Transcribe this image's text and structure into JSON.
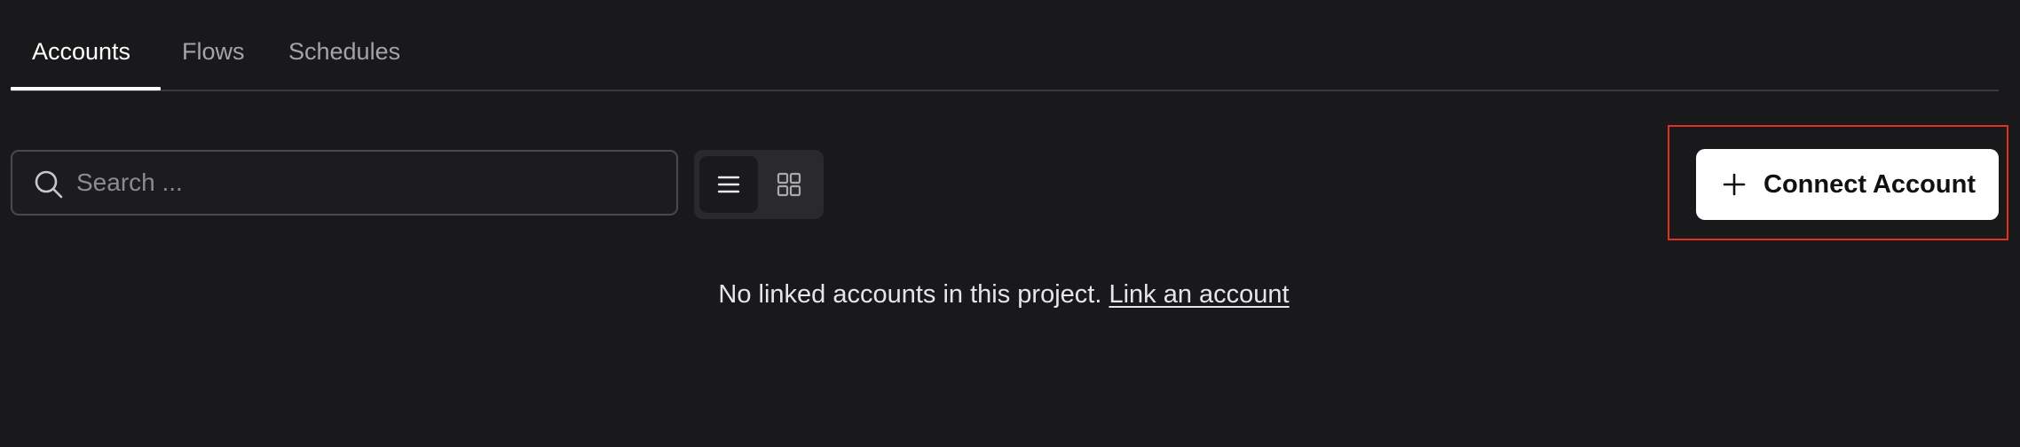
{
  "tabs": [
    {
      "label": "Accounts",
      "active": true
    },
    {
      "label": "Flows",
      "active": false
    },
    {
      "label": "Schedules",
      "active": false
    }
  ],
  "search": {
    "placeholder": "Search ...",
    "value": "",
    "icon": "search-icon"
  },
  "view_toggle": {
    "list_icon": "list-icon",
    "grid_icon": "grid-icon",
    "selected": "list"
  },
  "connect_button": {
    "label": "Connect Account",
    "icon": "plus-icon"
  },
  "empty_state": {
    "message": "No linked accounts in this project.",
    "link_label": "Link an account"
  },
  "colors": {
    "background": "#19191b",
    "highlight": "#e0321f",
    "button_bg": "#ffffff"
  }
}
